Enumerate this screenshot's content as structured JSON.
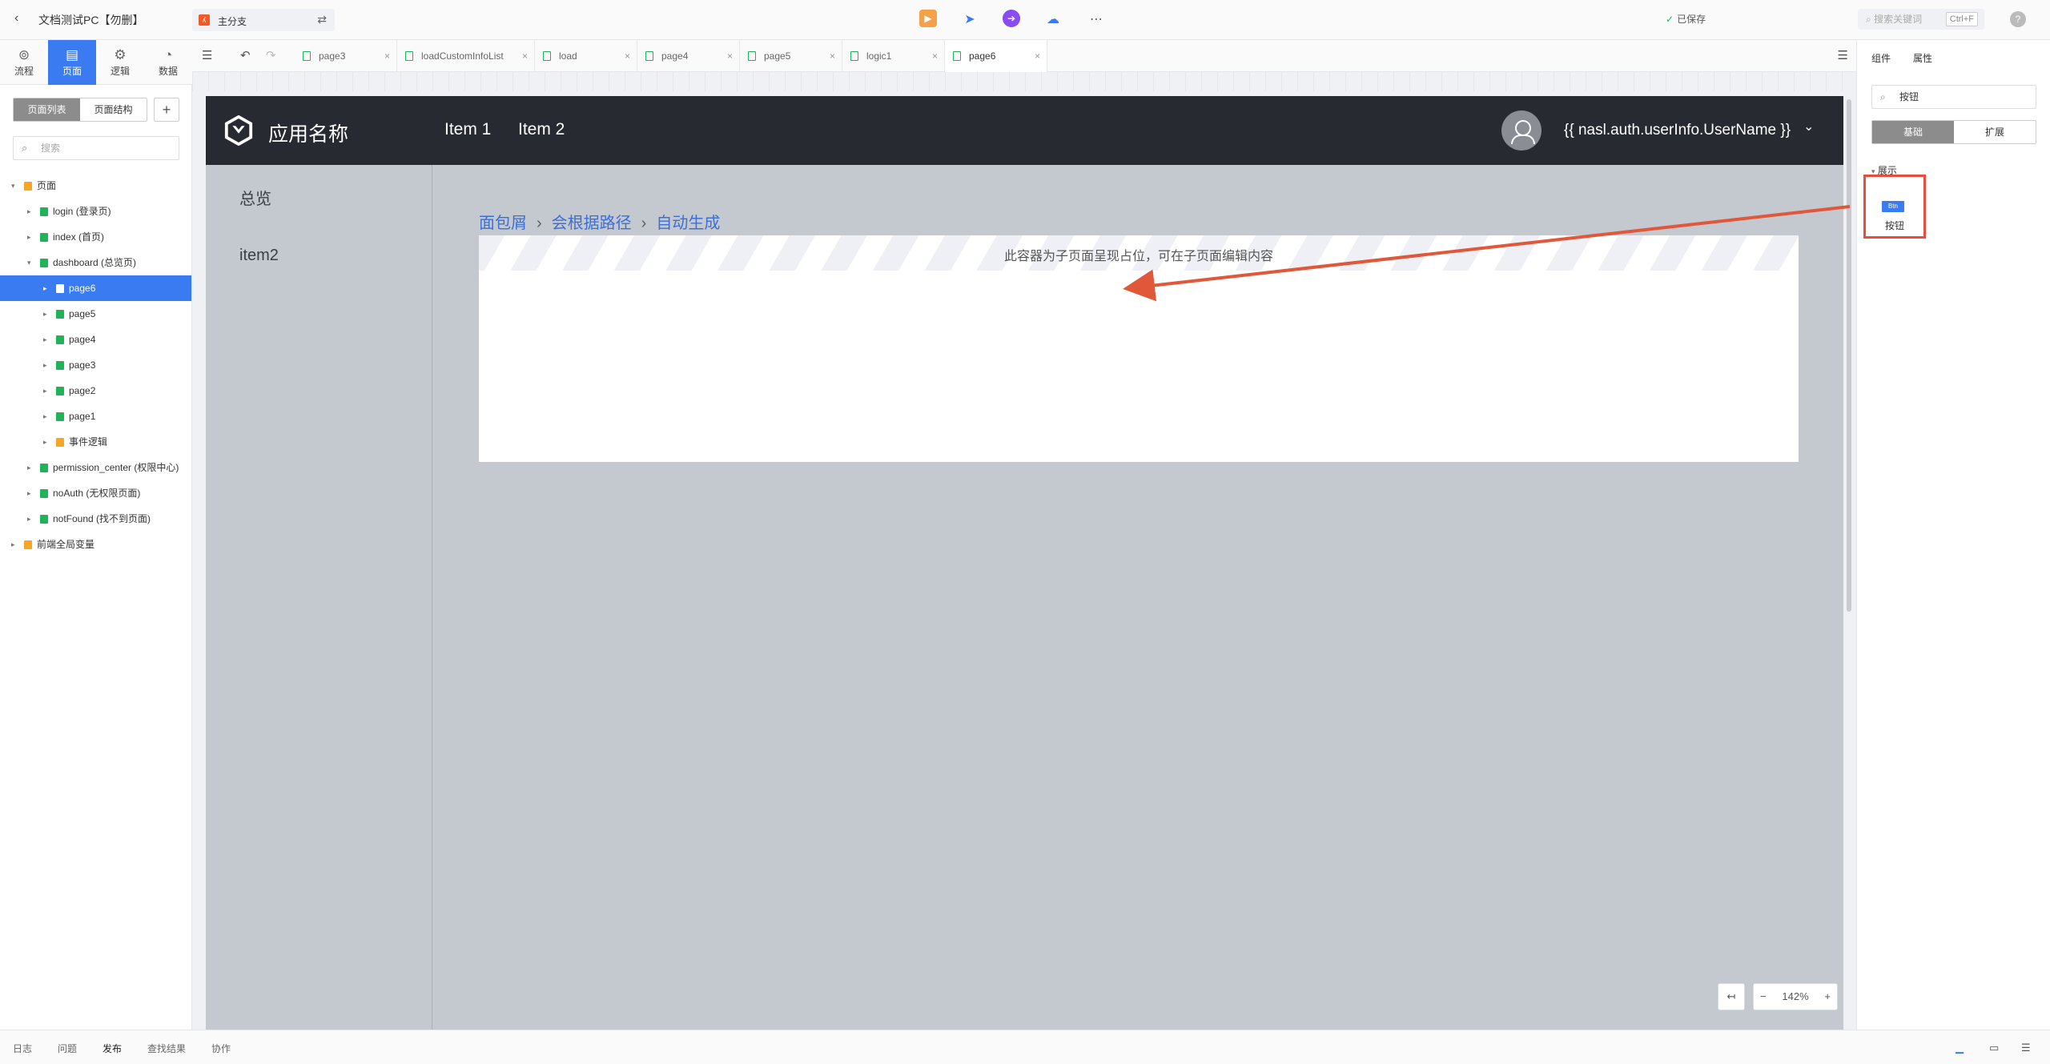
{
  "topbar": {
    "project_title": "文档测试PC【勿删】",
    "branch": "主分支",
    "saved": "已保存",
    "search_placeholder": "搜索关键词",
    "search_shortcut": "Ctrl+F",
    "help": "?"
  },
  "left_tabs": [
    {
      "label": "流程",
      "icon": "flow-icon"
    },
    {
      "label": "页面",
      "icon": "page-icon"
    },
    {
      "label": "逻辑",
      "icon": "logic-icon"
    },
    {
      "label": "数据",
      "icon": "data-icon"
    }
  ],
  "sidebar": {
    "seg_list": "页面列表",
    "seg_structure": "页面结构",
    "search_placeholder": "搜索",
    "tree": [
      {
        "label": "页面",
        "type": "folder",
        "indent": 0,
        "arrow": "▾"
      },
      {
        "label": "login (登录页)",
        "type": "page",
        "indent": 1,
        "arrow": "▸"
      },
      {
        "label": "index (首页)",
        "type": "page",
        "indent": 1,
        "arrow": "▸"
      },
      {
        "label": "dashboard (总览页)",
        "type": "page",
        "indent": 1,
        "arrow": "▾"
      },
      {
        "label": "page6",
        "type": "page",
        "indent": 2,
        "arrow": "▸",
        "selected": true
      },
      {
        "label": "page5",
        "type": "page",
        "indent": 2,
        "arrow": "▸"
      },
      {
        "label": "page4",
        "type": "page",
        "indent": 2,
        "arrow": "▸"
      },
      {
        "label": "page3",
        "type": "page",
        "indent": 2,
        "arrow": "▸"
      },
      {
        "label": "page2",
        "type": "page",
        "indent": 2,
        "arrow": "▸"
      },
      {
        "label": "page1",
        "type": "page",
        "indent": 2,
        "arrow": "▸"
      },
      {
        "label": "事件逻辑",
        "type": "folder",
        "indent": 2,
        "arrow": "▸"
      },
      {
        "label": "permission_center (权限中心)",
        "type": "page",
        "indent": 1,
        "arrow": "▸"
      },
      {
        "label": "noAuth (无权限页面)",
        "type": "page",
        "indent": 1,
        "arrow": "▸"
      },
      {
        "label": "notFound (找不到页面)",
        "type": "page",
        "indent": 1,
        "arrow": "▸"
      },
      {
        "label": "前端全局变量",
        "type": "folder",
        "indent": 0,
        "arrow": "▸"
      }
    ]
  },
  "editor_tabs": [
    "page3",
    "loadCustomInfoList",
    "load",
    "page4",
    "page5",
    "logic1",
    "page6"
  ],
  "active_tab": "page6",
  "app": {
    "name": "应用名称",
    "nav": [
      "Item 1",
      "Item 2"
    ],
    "username": "{{ nasl.auth.userInfo.UserName }}",
    "side_items": [
      "总览",
      "item2"
    ],
    "breadcrumb": [
      "面包屑",
      "会根据路径",
      "自动生成"
    ],
    "container_text": "此容器为子页面呈现占位，可在子页面编辑内容"
  },
  "zoom": {
    "fit": "↤",
    "minus": "−",
    "level": "142%",
    "plus": "+"
  },
  "right_panel": {
    "tab_components": "组件",
    "tab_properties": "属性",
    "search_value": "按钮",
    "seg_basic": "基础",
    "seg_ext": "扩展",
    "group": "展示",
    "component_label": "按钮",
    "component_badge": "Btn"
  },
  "statusbar": [
    "日志",
    "问题",
    "发布",
    "查找结果",
    "协作"
  ],
  "colors": {
    "accent": "#3a7bf2",
    "highlight": "#e74c3c",
    "app_header": "#272a30"
  }
}
